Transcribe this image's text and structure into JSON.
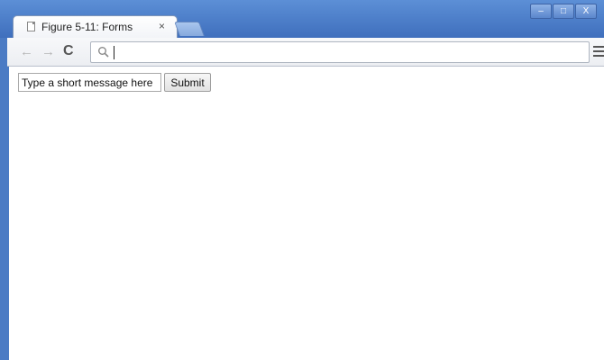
{
  "browser": {
    "tab": {
      "title": "Figure 5-11: Forms",
      "close_glyph": "×"
    },
    "window_controls": {
      "minimize": "–",
      "maximize": "□",
      "close": "X"
    },
    "nav": {
      "back": "←",
      "forward": "→",
      "reload": "C"
    },
    "omnibox": {
      "value": ""
    },
    "accent_color": "#4b7bc4"
  },
  "form": {
    "message_input": {
      "value": "Type a short message here"
    },
    "submit_label": "Submit"
  }
}
